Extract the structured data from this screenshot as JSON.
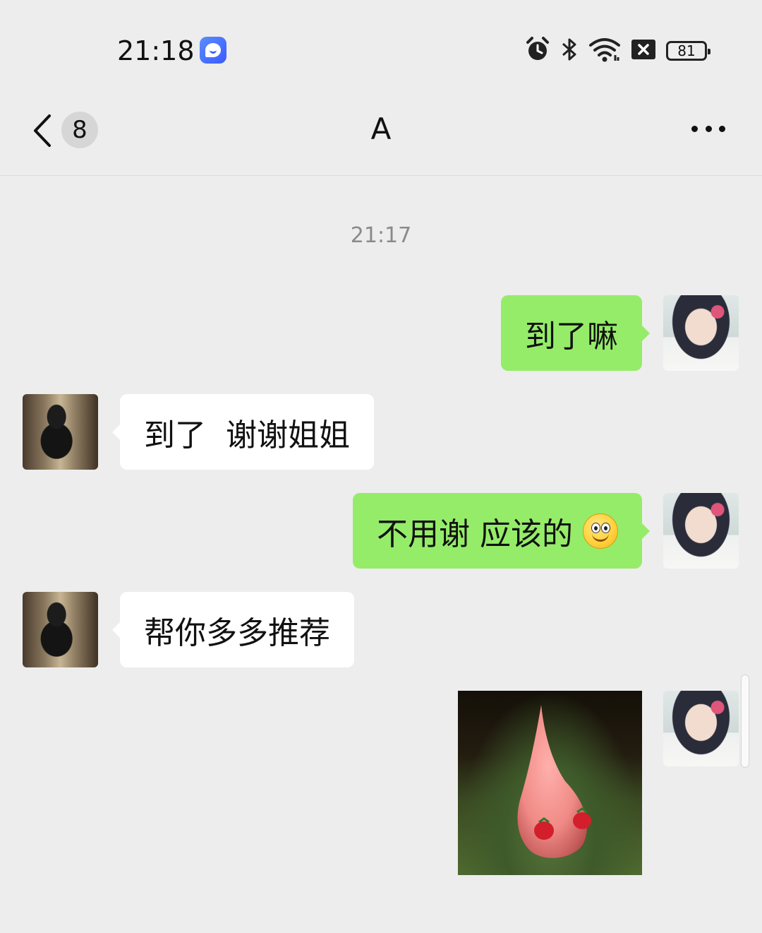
{
  "status_bar": {
    "time": "21:18",
    "app_notification_icon": "chat-bot-icon",
    "icons": [
      "alarm-icon",
      "bluetooth-icon",
      "wifi-icon",
      "sim-off-icon"
    ],
    "battery_level": "81"
  },
  "header": {
    "back_icon": "chevron-left-icon",
    "unread_count": "8",
    "title": "A",
    "more_icon": "more-dots-icon"
  },
  "messages": {
    "timestamp": "21:17",
    "m1": {
      "sender": "me",
      "text": "到了嘛"
    },
    "m2": {
      "sender": "other",
      "text": "到了  谢谢姐姐"
    },
    "m3": {
      "sender": "me",
      "text": "不用谢 应该的",
      "emoji": "smile-emoji"
    },
    "m4": {
      "sender": "other",
      "text": "帮你多多推荐"
    },
    "m5": {
      "sender": "me",
      "type": "sticker",
      "description_icon": "patrick-star-sticker"
    }
  },
  "colors": {
    "background": "#ededed",
    "my_bubble": "#95ec69",
    "their_bubble": "#ffffff",
    "timestamp_text": "#8a8a8a"
  }
}
